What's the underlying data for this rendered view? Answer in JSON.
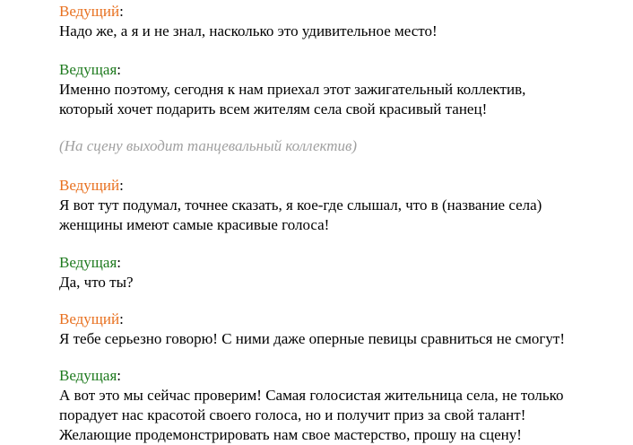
{
  "colors": {
    "male_speaker": "#e8701f",
    "female_speaker": "#1e7a1e",
    "stage_direction": "#a0a0a0",
    "text": "#000000"
  },
  "blocks": [
    {
      "type": "speech",
      "speaker": "Ведущий",
      "gender": "male",
      "lines": [
        "Надо же, а я и не знал, насколько это удивительное место!"
      ]
    },
    {
      "type": "speech",
      "speaker": "Ведущая",
      "gender": "female",
      "lines": [
        "Именно поэтому, сегодня к нам приехал этот зажигательный коллектив,",
        "который хочет подарить всем жителям села свой красивый танец!"
      ]
    },
    {
      "type": "stage",
      "text": "(На сцену выходит танцевальный коллектив)"
    },
    {
      "type": "speech",
      "speaker": "Ведущий",
      "gender": "male",
      "lines": [
        "Я вот тут подумал, точнее сказать, я кое-где слышал, что в (название села)",
        "женщины имеют самые красивые голоса!"
      ]
    },
    {
      "type": "speech",
      "speaker": "Ведущая",
      "gender": "female",
      "lines": [
        "Да, что ты?"
      ]
    },
    {
      "type": "speech",
      "speaker": "Ведущий",
      "gender": "male",
      "lines": [
        "Я тебе серьезно говорю! С ними даже оперные певицы сравниться не смогут!"
      ]
    },
    {
      "type": "speech",
      "speaker": "Ведущая",
      "gender": "female",
      "lines": [
        "А вот это мы сейчас проверим! Самая голосистая жительница села, не только",
        "порадует нас красотой своего голоса, но и получит приз за свой талант!",
        "Желающие продемонстрировать нам свое мастерство, прошу на сцену!"
      ]
    }
  ]
}
